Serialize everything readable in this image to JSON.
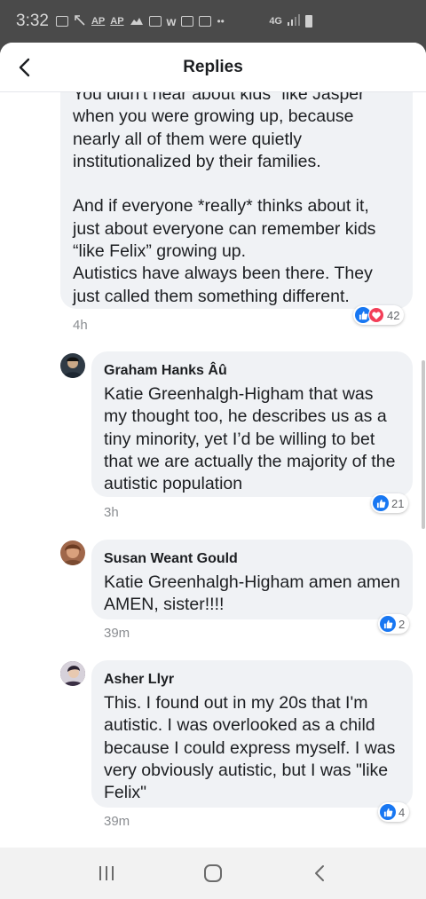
{
  "status_bar": {
    "time": "3:32",
    "icons": [
      "message-icon",
      "missed-call-icon",
      "ap-news-icon",
      "ap-news-icon",
      "weather-icon",
      "news-icon",
      "w-app-icon",
      "gallery-icon",
      "calendar-icon",
      "more-dots-icon"
    ],
    "ap1": "AP",
    "ap2": "AP",
    "network": "4G"
  },
  "header": {
    "title": "Replies",
    "back_icon": "chevron-left-icon"
  },
  "parent_comment": {
    "clipped_line": "You didn't hear about kids \"like Jasper\"",
    "text": "when you were growing up, because nearly all of them were quietly institutionalized by their families.\n\nAnd if everyone *really* thinks about it, just about everyone can remember kids “like Felix” growing up.\nAutistics have always been there. They just called them something different.",
    "time": "4h",
    "reaction_count": "42",
    "reactions": [
      "like",
      "love"
    ]
  },
  "replies": [
    {
      "name": "Graham Hanks Âû",
      "text": "Katie Greenhalgh-Higham that was my thought too, he describes us as a tiny minority, yet I’d be willing to bet that we are actually the majority of the autistic population",
      "time": "3h",
      "reaction_count": "21",
      "avatar_color": "#2f3a45"
    },
    {
      "name": "Susan Weant Gould",
      "text": "Katie Greenhalgh-Higham amen amen AMEN, sister!!!!",
      "time": "39m",
      "reaction_count": "2",
      "avatar_color": "#a0674a"
    },
    {
      "name": "Asher Llyr",
      "text": "This. I found out in my 20s that I'm autistic. I was overlooked as a child because I could express myself. I was very obviously autistic, but I was \"like Felix\"",
      "time": "39m",
      "reaction_count": "4",
      "avatar_color": "#5a4a60"
    }
  ],
  "nav": {
    "recents_icon": "recents-icon",
    "home_icon": "home-icon",
    "back_icon": "back-arrow-icon"
  },
  "colors": {
    "like_blue": "#1877f2",
    "love_red": "#f33e58",
    "bubble_gray": "#f0f2f5",
    "status_bg": "#4a4a4a"
  }
}
